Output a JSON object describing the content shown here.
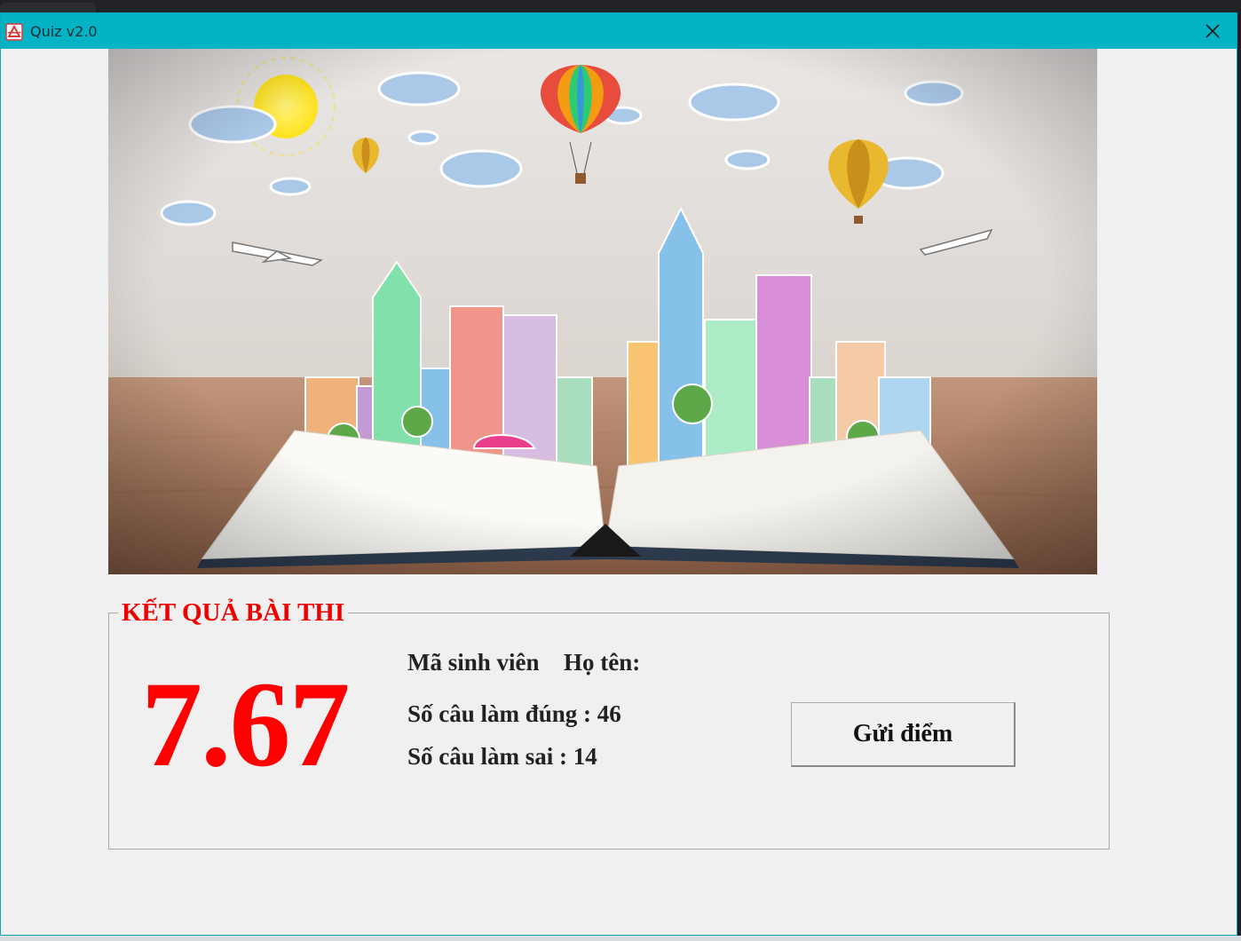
{
  "window": {
    "title": "Quiz v2.0",
    "titlebar_color": "#03b3c4"
  },
  "banner": {
    "image": "open-book-with-drawn-city-balloons-airplanes"
  },
  "result": {
    "heading": "KẾT QUẢ BÀI THI",
    "score": "7.67",
    "student_id_label": "Mã sinh viên",
    "student_id_value": "",
    "name_label": "Họ tên:",
    "name_value": "",
    "correct_text": "Số câu làm đúng : 46",
    "wrong_text": "Số câu làm sai : 14",
    "correct_count": 46,
    "wrong_count": 14,
    "send_button_label": "Gửi điểm",
    "score_color": "#ff0000",
    "heading_color": "#ee0000"
  }
}
